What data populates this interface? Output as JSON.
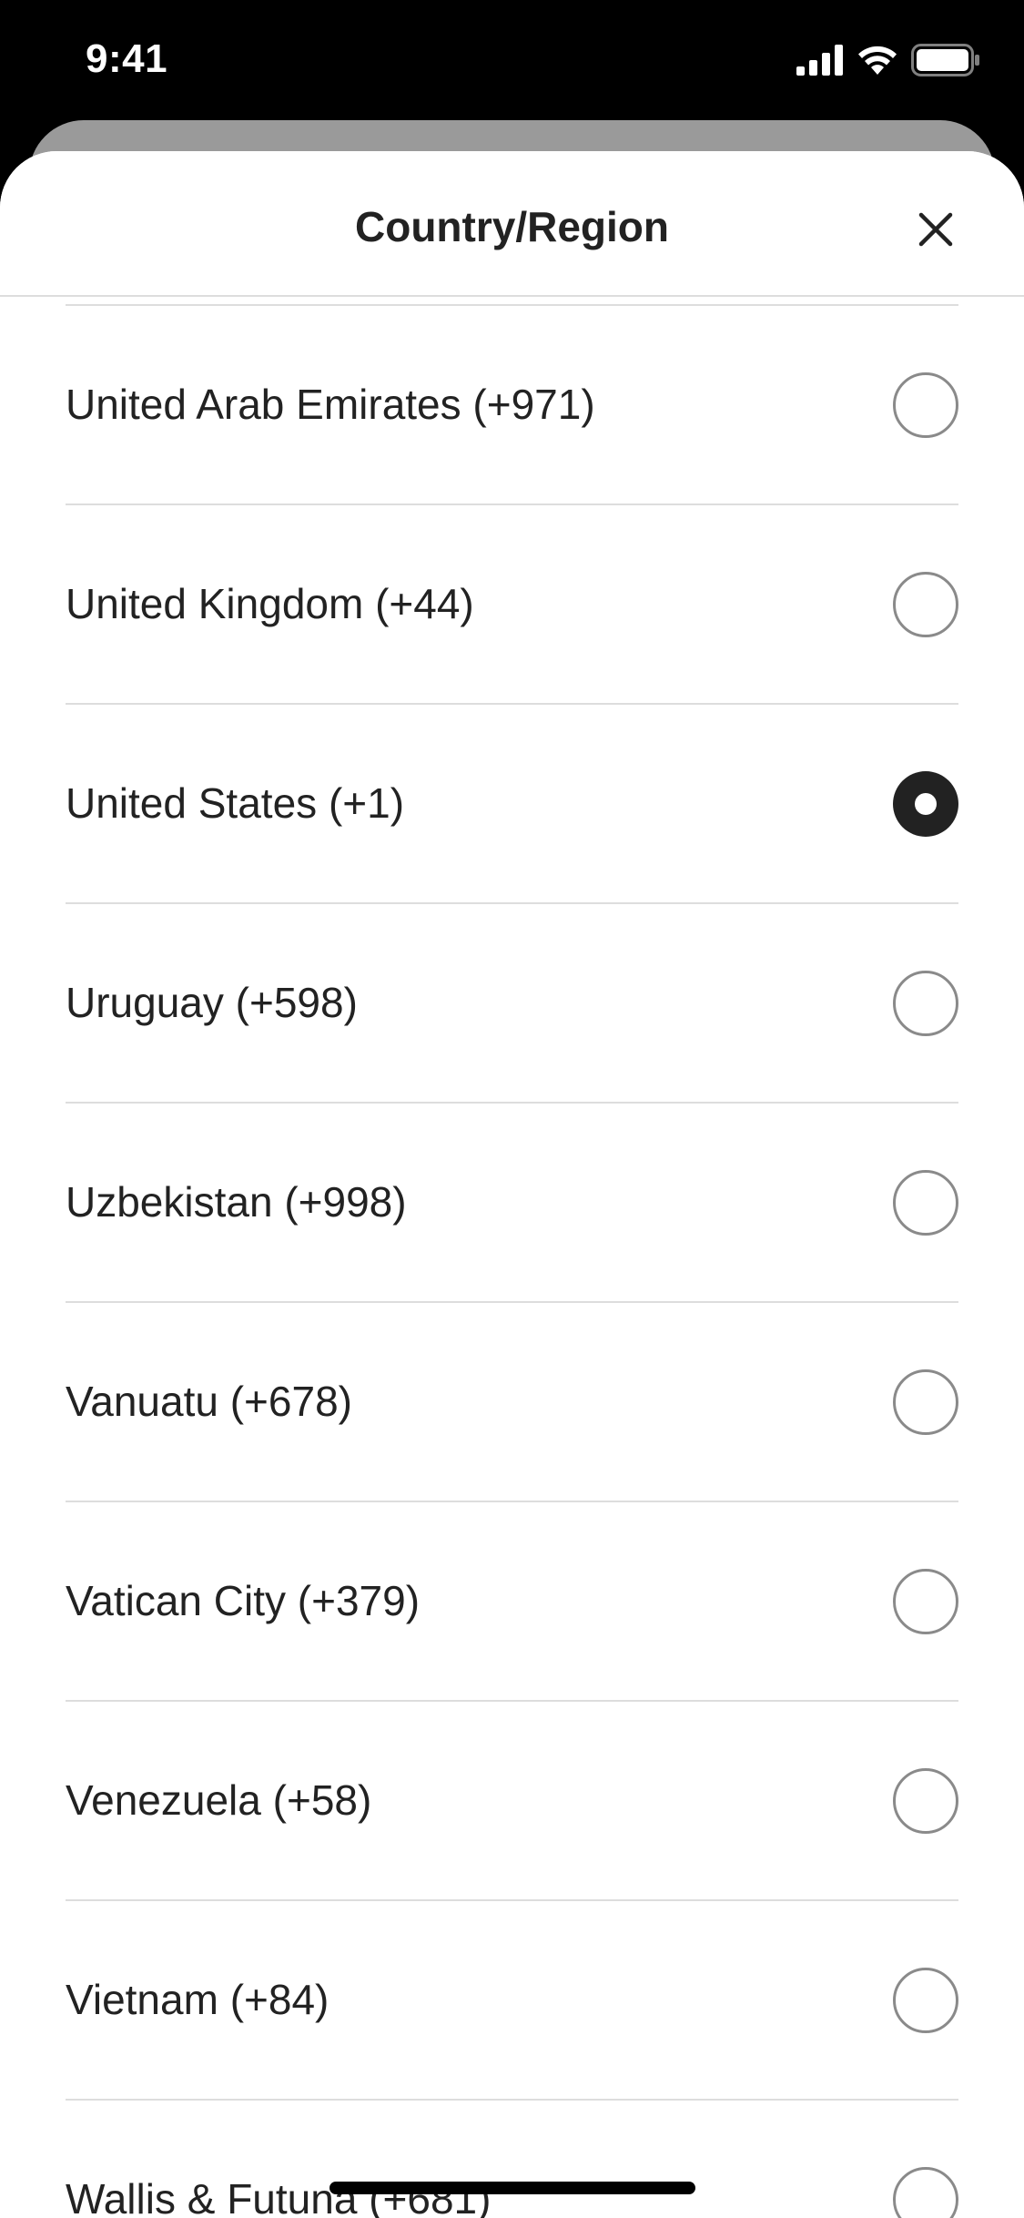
{
  "status_bar": {
    "time": "9:41",
    "icons": [
      "cellular-signal-icon",
      "wifi-icon",
      "battery-icon"
    ]
  },
  "sheet": {
    "title": "Country/Region",
    "close_icon": "close-icon"
  },
  "countries": [
    {
      "label": "United Arab Emirates (+971)",
      "selected": false
    },
    {
      "label": "United Kingdom (+44)",
      "selected": false
    },
    {
      "label": "United States (+1)",
      "selected": true
    },
    {
      "label": "Uruguay (+598)",
      "selected": false
    },
    {
      "label": "Uzbekistan (+998)",
      "selected": false
    },
    {
      "label": "Vanuatu (+678)",
      "selected": false
    },
    {
      "label": "Vatican City (+379)",
      "selected": false
    },
    {
      "label": "Venezuela (+58)",
      "selected": false
    },
    {
      "label": "Vietnam (+84)",
      "selected": false
    },
    {
      "label": "Wallis & Futuna (+681)",
      "selected": false
    }
  ],
  "colors": {
    "text": "#222222",
    "divider": "#dddddd",
    "radio_border": "#8a8a8a",
    "selected": "#222222"
  }
}
